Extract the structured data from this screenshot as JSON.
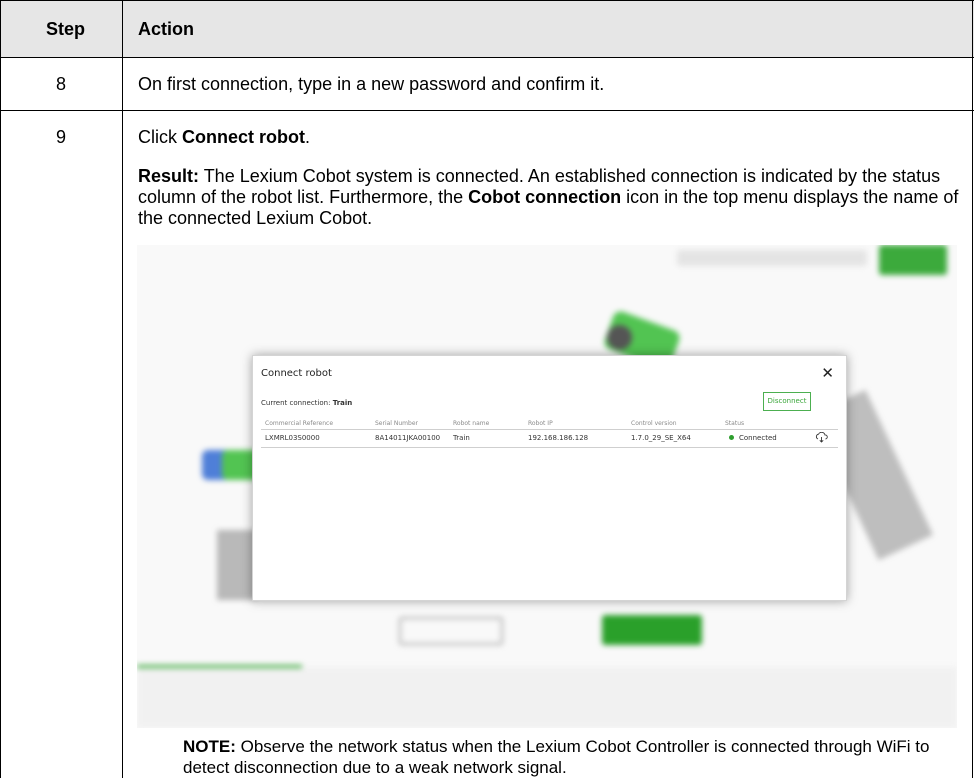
{
  "table": {
    "header": {
      "step": "Step",
      "action": "Action"
    },
    "rows": [
      {
        "step": "8",
        "action": "On first connection, type in a new password and confirm it."
      },
      {
        "step": "9",
        "click_prefix": "Click ",
        "click_bold": "Connect robot",
        "click_suffix": ".",
        "result_label": "Result:",
        "result_text_1": " The Lexium Cobot system is connected. An established connection is indicated by the status column of the robot list. Furthermore, the ",
        "result_bold": "Cobot connection",
        "result_text_2": " icon in the top menu displays the name of the connected Lexium Cobot."
      }
    ]
  },
  "screenshot": {
    "dialog": {
      "title": "Connect robot",
      "close": "✕",
      "current_connection_label": "Current connection:",
      "current_connection_value": "Train",
      "disconnect_label": "Disconnect",
      "columns": [
        "Commercial Reference",
        "Serial Number",
        "Robot name",
        "Robot IP",
        "Control version",
        "Status"
      ],
      "row": {
        "commercial_reference": "LXMRL03S0000",
        "serial_number": "8A14011JKA00100",
        "robot_name": "Train",
        "robot_ip": "192.168.186.128",
        "control_version": "1.7.0_29_SE_X64",
        "status": "Connected"
      },
      "status_color": "#2e9e2e"
    }
  },
  "note": {
    "label": "NOTE:",
    "text": " Observe the network status when the Lexium Cobot Controller is connected through WiFi to detect disconnection due to a weak network signal."
  }
}
